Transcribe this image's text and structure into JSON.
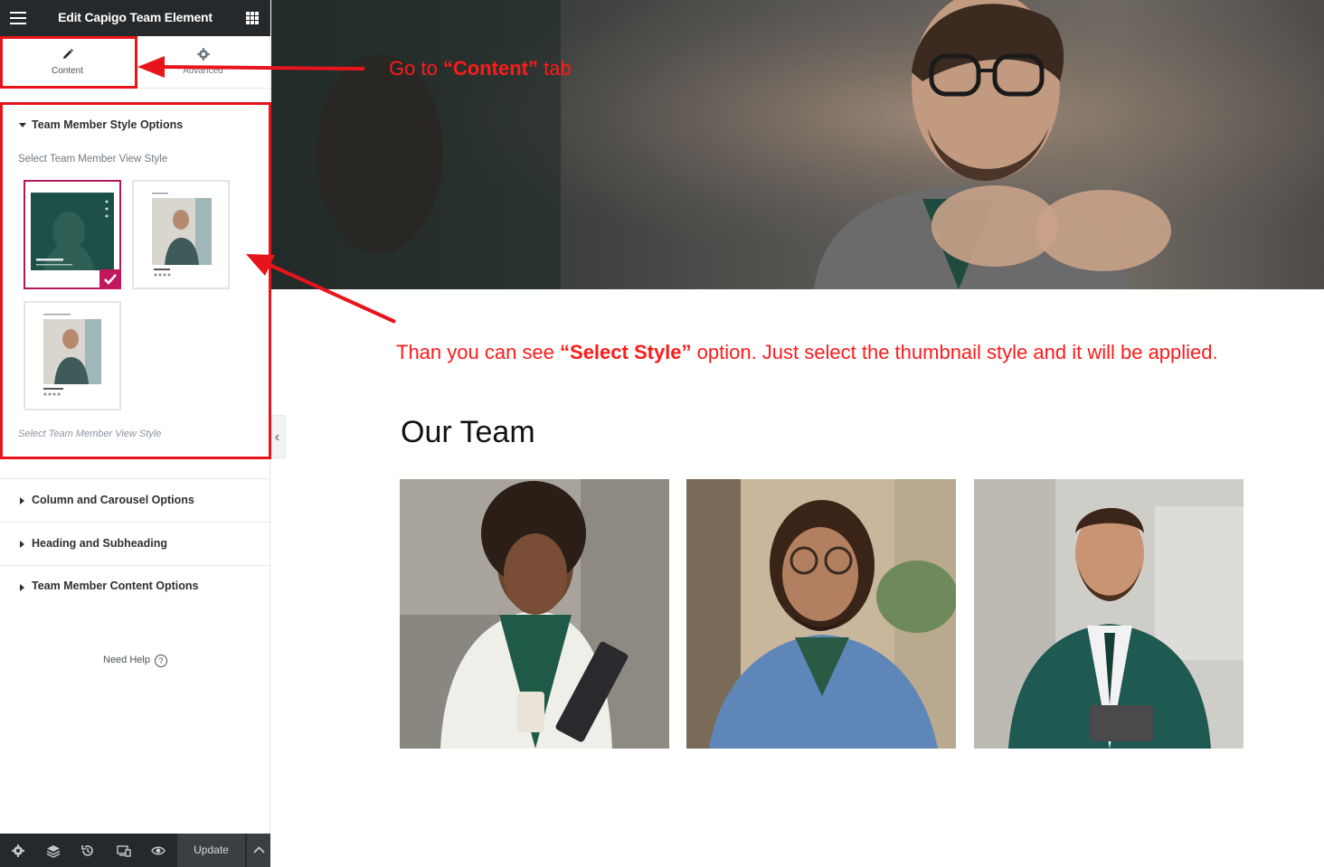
{
  "panel": {
    "title": "Edit Capigo Team Element",
    "tabs": [
      {
        "label": "Content",
        "icon": "pencil-icon"
      },
      {
        "label": "Advanced",
        "icon": "gear-icon"
      }
    ],
    "open_section": {
      "title": "Team Member Style Options",
      "control_label": "Select Team Member View Style",
      "control_description": "Select Team Member View Style",
      "thumbnails": [
        {
          "name": "Edward Smith",
          "role": "Marketing Manager",
          "selected": true
        },
        {
          "name": "Edward Smith",
          "selected": false
        },
        {
          "name": "Edward Smith",
          "selected": false
        }
      ]
    },
    "sections": [
      {
        "label": "Column and Carousel Options"
      },
      {
        "label": "Heading and Subheading"
      },
      {
        "label": "Team Member Content Options"
      }
    ],
    "need_help": "Need Help",
    "footer": {
      "icons": [
        "gear-icon",
        "layers-icon",
        "history-icon",
        "responsive-icon",
        "eye-icon"
      ],
      "update_label": "Update"
    }
  },
  "canvas": {
    "heading": "Our Team",
    "cards": [
      {
        "image": "woman-with-coffee-and-folder"
      },
      {
        "image": "man-with-glasses-denim-jacket"
      },
      {
        "image": "man-in-green-suit-with-tablet"
      }
    ]
  },
  "annotations": {
    "tab_hint_prefix": "Go  to ",
    "tab_hint_bold": "“Content”",
    "tab_hint_suffix": " tab",
    "style_hint_prefix": "Than you can see ",
    "style_hint_bold": "“Select Style”",
    "style_hint_suffix": " option. Just select the thumbnail style and it will be applied.",
    "color": "#ff1a1a"
  }
}
